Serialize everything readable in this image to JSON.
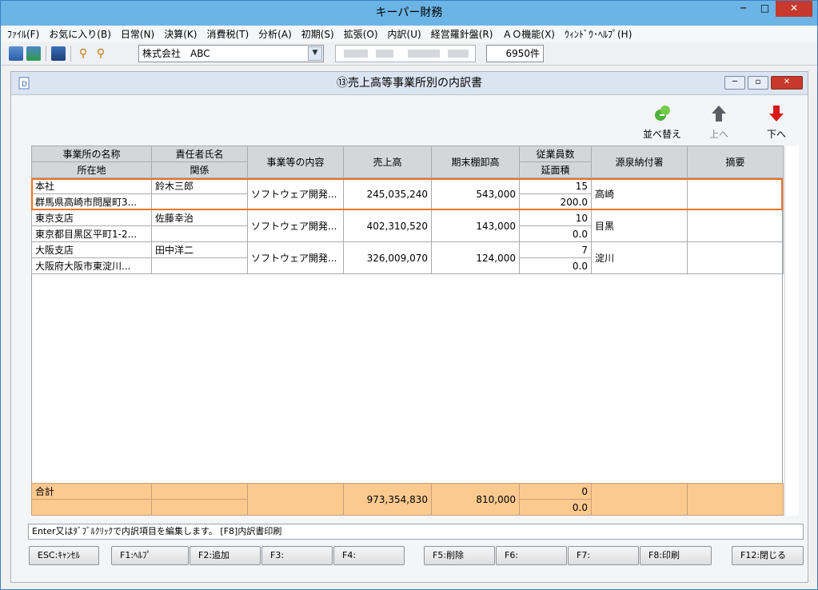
{
  "app": {
    "title": "キーパー財務"
  },
  "menu": [
    "ﾌｧｲﾙ(F)",
    "お気に入り(B)",
    "日常(N)",
    "決算(K)",
    "消費税(T)",
    "分析(A)",
    "初期(S)",
    "拡張(O)",
    "内訳(U)",
    "経営羅針盤(R)",
    "ＡＯ機能(X)",
    "ｳｨﾝﾄﾞｳ･ﾍﾙﾌﾟ(H)"
  ],
  "toolbar": {
    "company": "株式会社　ABC",
    "count": "6950件"
  },
  "doc": {
    "title": "⑬売上高等事業所別の内訳書"
  },
  "actions": {
    "sort": "並べ替え",
    "up": "上へ",
    "down": "下へ"
  },
  "headers": {
    "name": "事業所の名称",
    "location": "所在地",
    "person": "責任者氏名",
    "relation": "関係",
    "content": "事業等の内容",
    "sales": "売上高",
    "inventory": "期末棚卸高",
    "employees": "従業員数",
    "area": "延面積",
    "tax_office": "源泉納付署",
    "remarks": "摘要"
  },
  "rows": [
    {
      "name": "本社",
      "location": "群馬県高崎市問屋町3...",
      "person": "鈴木三郎",
      "relation": "",
      "content": "ソフトウェア開発...",
      "sales": "245,035,240",
      "inventory": "543,000",
      "employees": "15",
      "area": "200.0",
      "tax_office": "高崎",
      "remarks": ""
    },
    {
      "name": "東京支店",
      "location": "東京都目黒区平町1-2...",
      "person": "佐藤幸治",
      "relation": "",
      "content": "ソフトウェア開発...",
      "sales": "402,310,520",
      "inventory": "143,000",
      "employees": "10",
      "area": "0.0",
      "tax_office": "目黒",
      "remarks": ""
    },
    {
      "name": "大阪支店",
      "location": "大阪府大阪市東淀川...",
      "person": "田中洋二",
      "relation": "",
      "content": "ソフトウェア開発...",
      "sales": "326,009,070",
      "inventory": "124,000",
      "employees": "7",
      "area": "0.0",
      "tax_office": "淀川",
      "remarks": ""
    }
  ],
  "total": {
    "label": "合計",
    "sales": "973,354,830",
    "inventory": "810,000",
    "employees": "0",
    "area": "0.0"
  },
  "status": "Enter又はﾀﾞﾌﾞﾙｸﾘｯｸで内訳項目を編集します。 [F8]内訳書印刷",
  "fkeys": [
    "ESC:ｷｬﾝｾﾙ",
    "F1:ﾍﾙﾌﾟ",
    "F2:追加",
    "F3:",
    "F4:",
    "F5:削除",
    "F6:",
    "F7:",
    "F8:印刷",
    "F12:閉じる"
  ],
  "colors": {
    "highlight": "#ee7326",
    "total_bg": "#fcc98f",
    "title_bar": "#6cb4e6"
  }
}
